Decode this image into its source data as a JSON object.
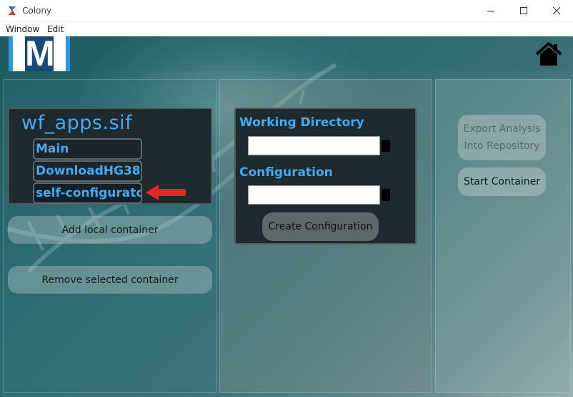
{
  "window": {
    "title": "Colony",
    "menu": [
      "Window",
      "Edit"
    ]
  },
  "header": {
    "logo_letter": "M",
    "home_icon": "home-icon"
  },
  "containers": {
    "title": "wf_apps.sif",
    "items": [
      "Main",
      "DownloadHG38",
      "self-configurator"
    ],
    "selected": "self-configurator",
    "add_label": "Add local container",
    "remove_label": "Remove selected container"
  },
  "configuration": {
    "working_directory_label": "Working Directory",
    "working_directory_value": "",
    "configuration_label": "Configuration",
    "configuration_value": "",
    "create_label": "Create Configuration"
  },
  "actions": {
    "export_label_line1": "Export Analysis",
    "export_label_line2": "Into Repository",
    "start_label": "Start Container"
  },
  "colors": {
    "accent_blue": "#46a8f0",
    "annotation_red": "#e8262a",
    "dark_box": "#1f2a2e"
  }
}
